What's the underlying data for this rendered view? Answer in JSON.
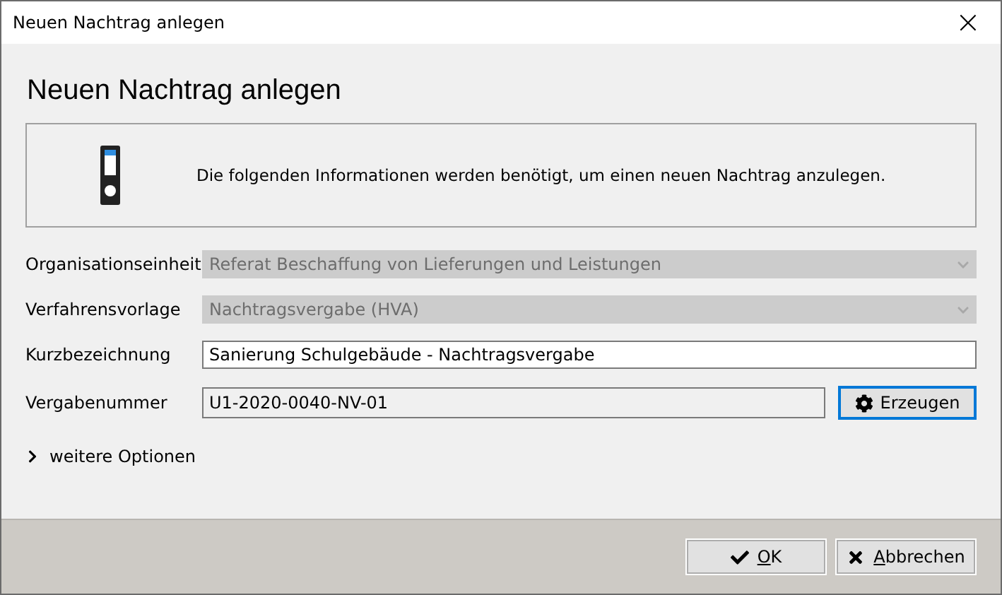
{
  "window": {
    "title": "Neuen Nachtrag anlegen",
    "close": "×"
  },
  "heading": "Neuen Nachtrag anlegen",
  "info": "Die folgenden Informationen werden benötigt, um einen neuen Nachtrag anzulegen.",
  "fields": [
    {
      "kind": "select",
      "label": "Organisationseinheit",
      "value": "Referat Beschaffung von Lieferungen und Leistungen",
      "disabled": true
    },
    {
      "kind": "select",
      "label": "Verfahrensvorlage",
      "value": "Nachtragsvergabe (HVA)",
      "disabled": true
    },
    {
      "kind": "text",
      "label": "Kurzbezeichnung",
      "value": "Sanierung Schulgebäude - Nachtragsvergabe",
      "disabled": false
    },
    {
      "kind": "generate",
      "label": "Vergabenummer",
      "value": "U1-2020-0040-NV-01",
      "disabled": false,
      "button": "Erzeugen"
    }
  ],
  "more_options": {
    "label": "weitere Optionen",
    "expanded": false
  },
  "buttons": [
    {
      "kind": "ok",
      "label": "OK",
      "mnemonic_first": true
    },
    {
      "kind": "cancel",
      "label": "Abbrechen",
      "mnemonic_first": true
    }
  ]
}
